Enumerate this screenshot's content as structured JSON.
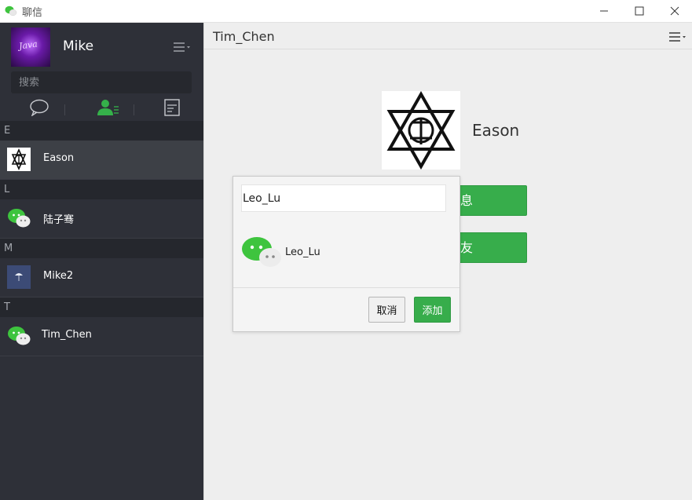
{
  "window": {
    "title": "聊信",
    "controls": [
      "minimize-icon",
      "maximize-icon",
      "close-icon"
    ]
  },
  "sidebar": {
    "profile": {
      "name": "Mike",
      "avatar_text": "Java"
    },
    "search": {
      "placeholder": "搜索",
      "value": ""
    },
    "tabs": [
      {
        "icon": "chat-bubble-icon",
        "active": false
      },
      {
        "icon": "contacts-icon",
        "active": true
      },
      {
        "icon": "document-icon",
        "active": false
      }
    ],
    "groups": [
      {
        "letter": "E",
        "contacts": [
          {
            "name": "Eason",
            "avatar": "star-emblem-avatar",
            "active": true
          }
        ]
      },
      {
        "letter": "L",
        "contacts": [
          {
            "name": "陆子骞",
            "avatar": "wechat-logo-avatar",
            "active": false
          }
        ]
      },
      {
        "letter": "M",
        "contacts": [
          {
            "name": "Mike2",
            "avatar": "umbrella-avatar",
            "active": false
          }
        ]
      },
      {
        "letter": "T",
        "contacts": [
          {
            "name": "Tim_Chen",
            "avatar": "wechat-logo-avatar",
            "active": false
          }
        ]
      }
    ]
  },
  "main": {
    "title": "Tim_Chen",
    "contact": {
      "name": "Eason"
    },
    "send_button_label": "息",
    "delete_button_label": "友"
  },
  "dialog": {
    "input_value": "Leo_Lu",
    "result": {
      "name": "Leo_Lu"
    },
    "cancel_label": "取消",
    "add_label": "添加"
  },
  "colors": {
    "sidebar_bg": "#2e3038",
    "accent_green": "#37ad4b",
    "main_bg": "#eeeeee"
  }
}
